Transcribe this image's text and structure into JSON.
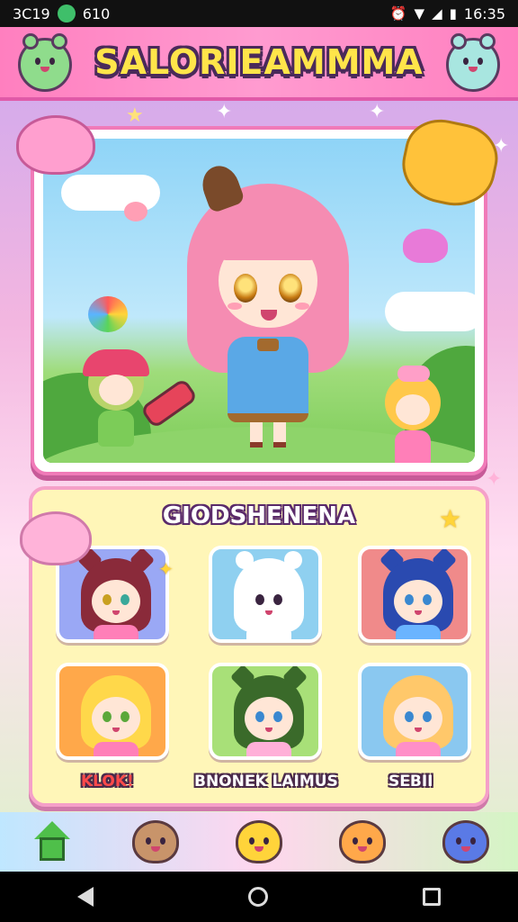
{
  "status_bar": {
    "left_text_1": "3C19",
    "left_text_2": "610",
    "time": "16:35"
  },
  "header": {
    "title": "SALORIEAMMMA"
  },
  "characters_panel": {
    "title": "GIODSHENENA",
    "labels": [
      "KLOK!",
      "BNONEK LAIMUS",
      "SEBII"
    ]
  },
  "colors": {
    "header_pink": "#ff7fbf",
    "title_yellow": "#ffe54a",
    "panel_yellow": "#fff6b8",
    "label_red": "#ff4a4a"
  },
  "icons": {
    "header_left": "green-bear-icon",
    "header_right": "mint-bear-icon",
    "nav": [
      "home-icon",
      "bear-icon",
      "yellow-cat-icon",
      "orange-bear-icon",
      "blue-bear-icon"
    ]
  }
}
